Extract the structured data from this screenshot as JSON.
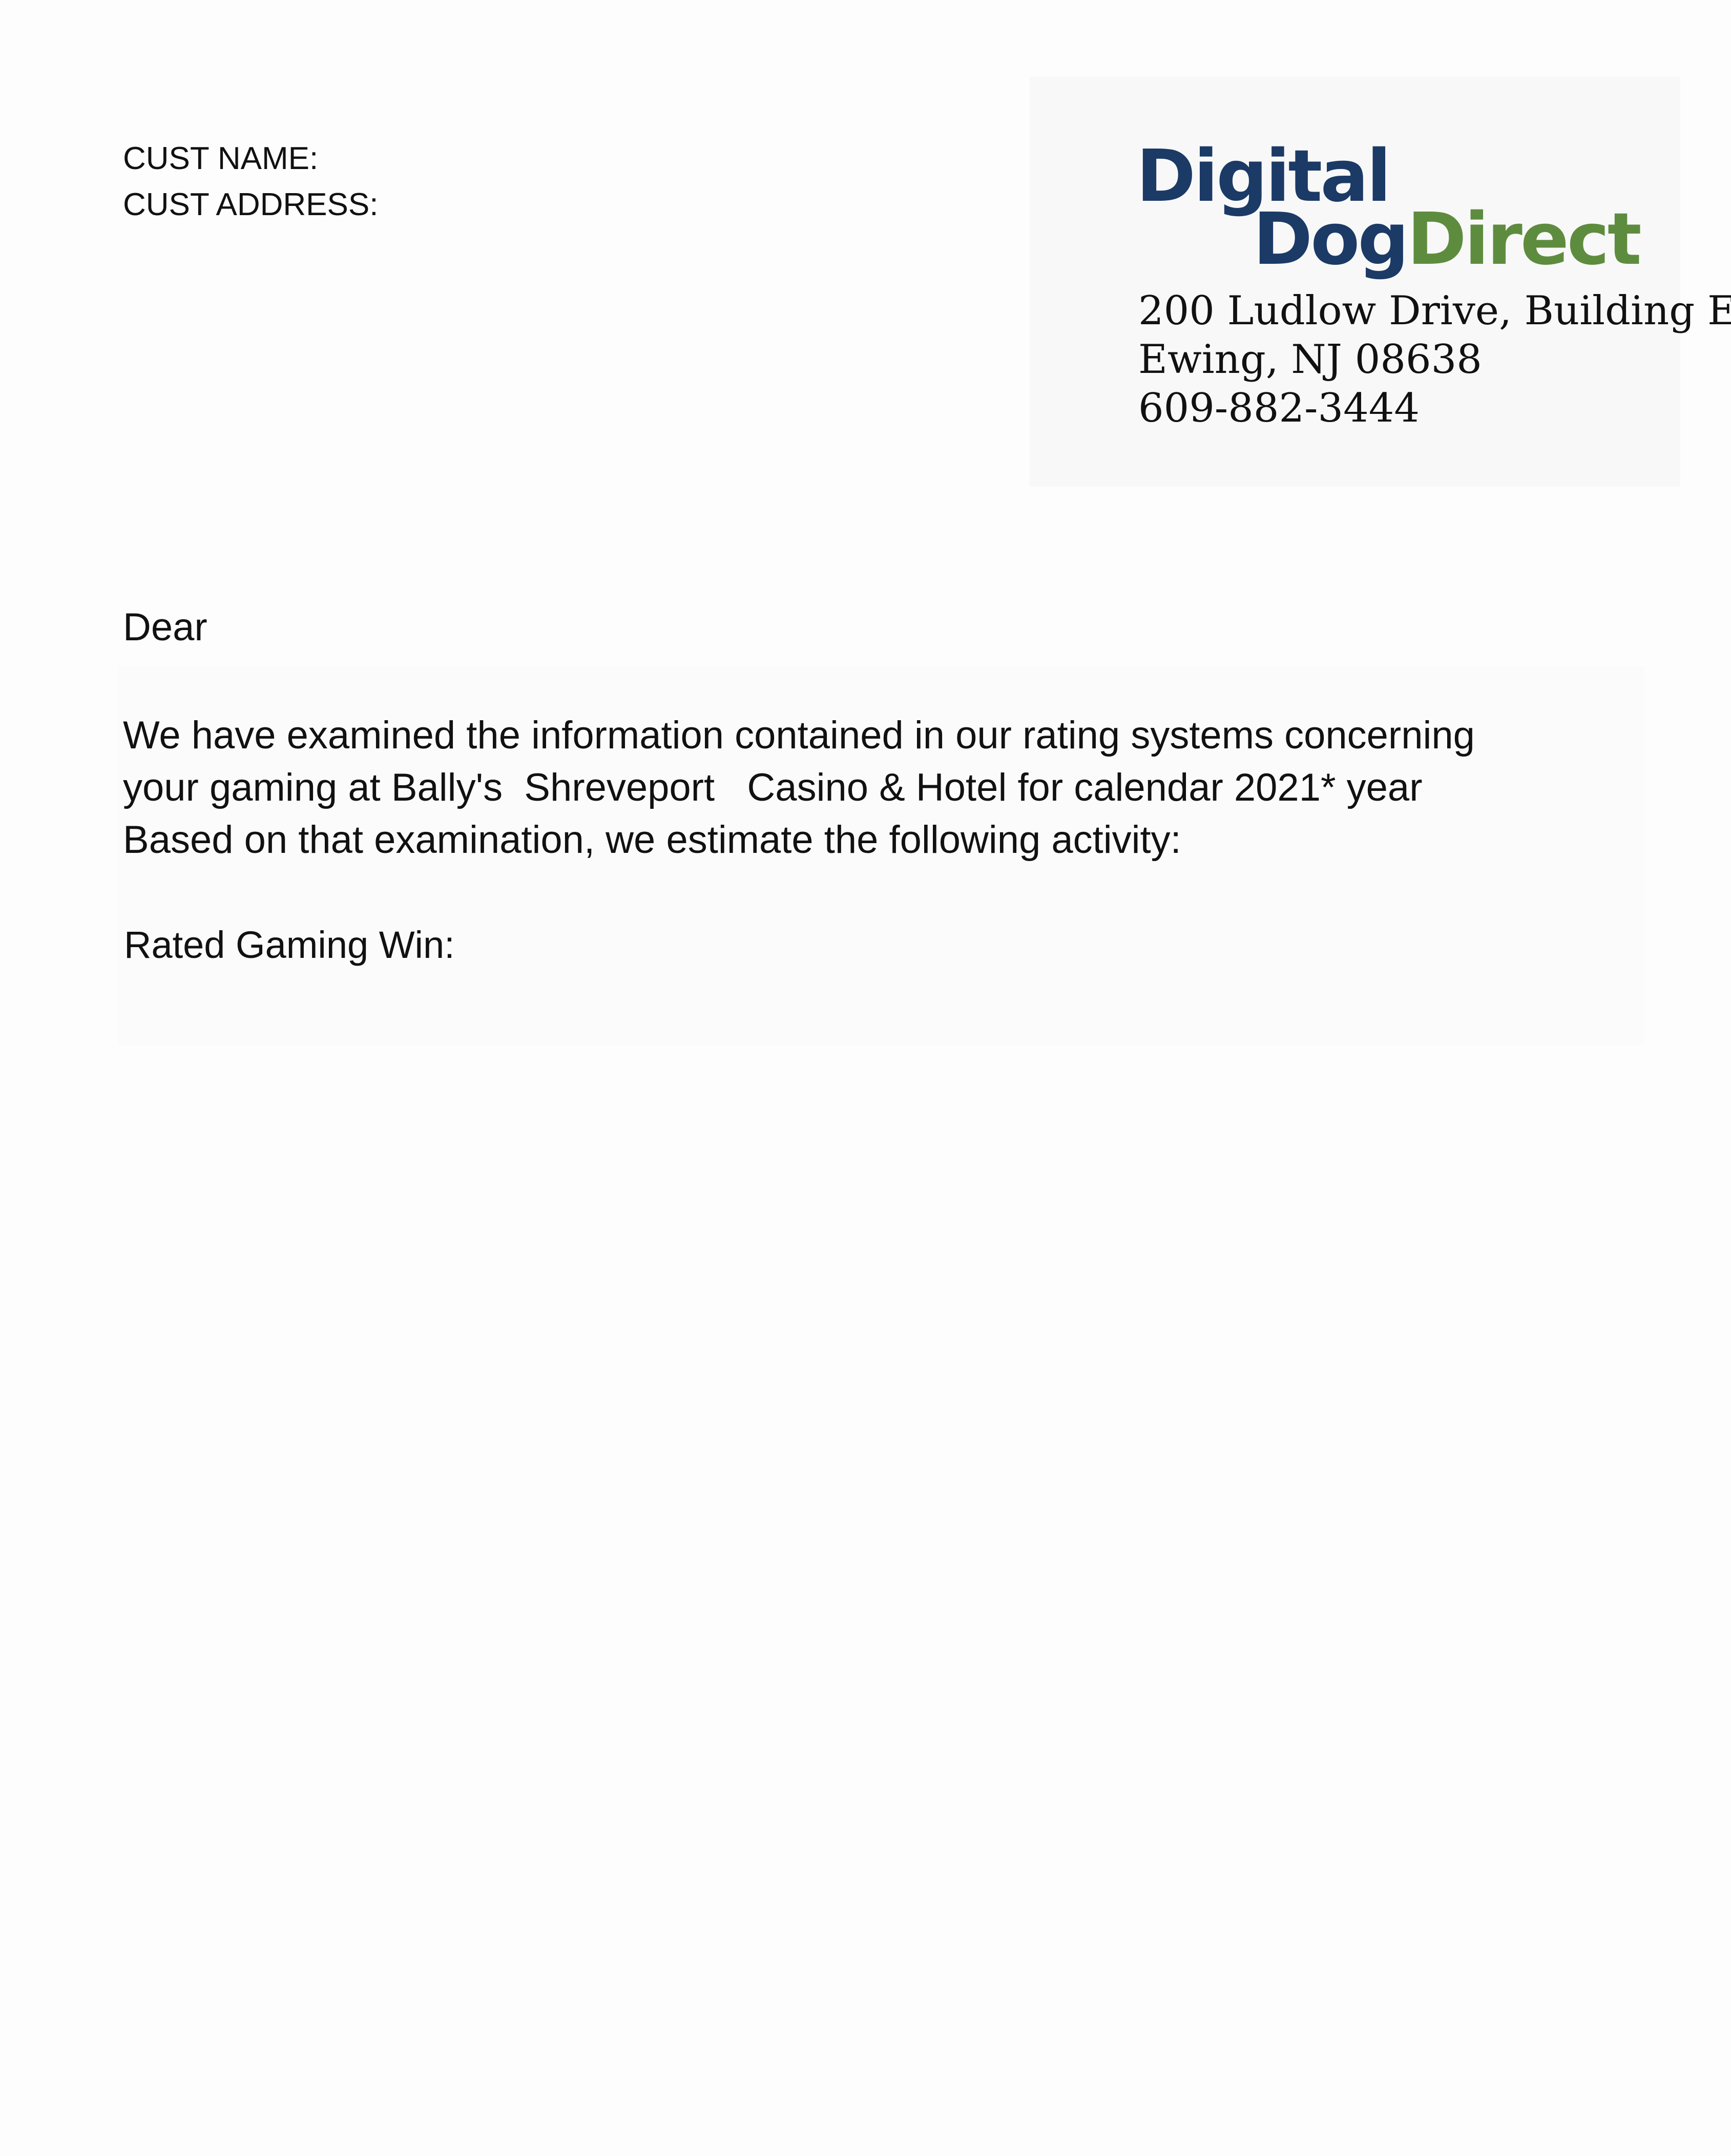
{
  "customer": {
    "name_label": "CUST NAME:",
    "address_label": "CUST ADDRESS:"
  },
  "logo": {
    "word1": "Digital",
    "word2": "Dog",
    "word3": "Direct",
    "colors": {
      "navy": "#1b3a66",
      "green": "#5e8c3e"
    }
  },
  "company_address": {
    "street": "200 Ludlow Drive, Building E",
    "city_state_zip": "Ewing, NJ 08638",
    "phone": "609-882-3444"
  },
  "letter": {
    "salutation": "Dear",
    "body_lines": [
      "We have examined the information contained in our rating systems concerning",
      "your gaming at Bally's  Shreveport   Casino & Hotel for calendar 2021* year",
      "Based on that examination, we estimate the following activity:"
    ],
    "rated_gaming_win_label": "Rated Gaming Win:"
  }
}
